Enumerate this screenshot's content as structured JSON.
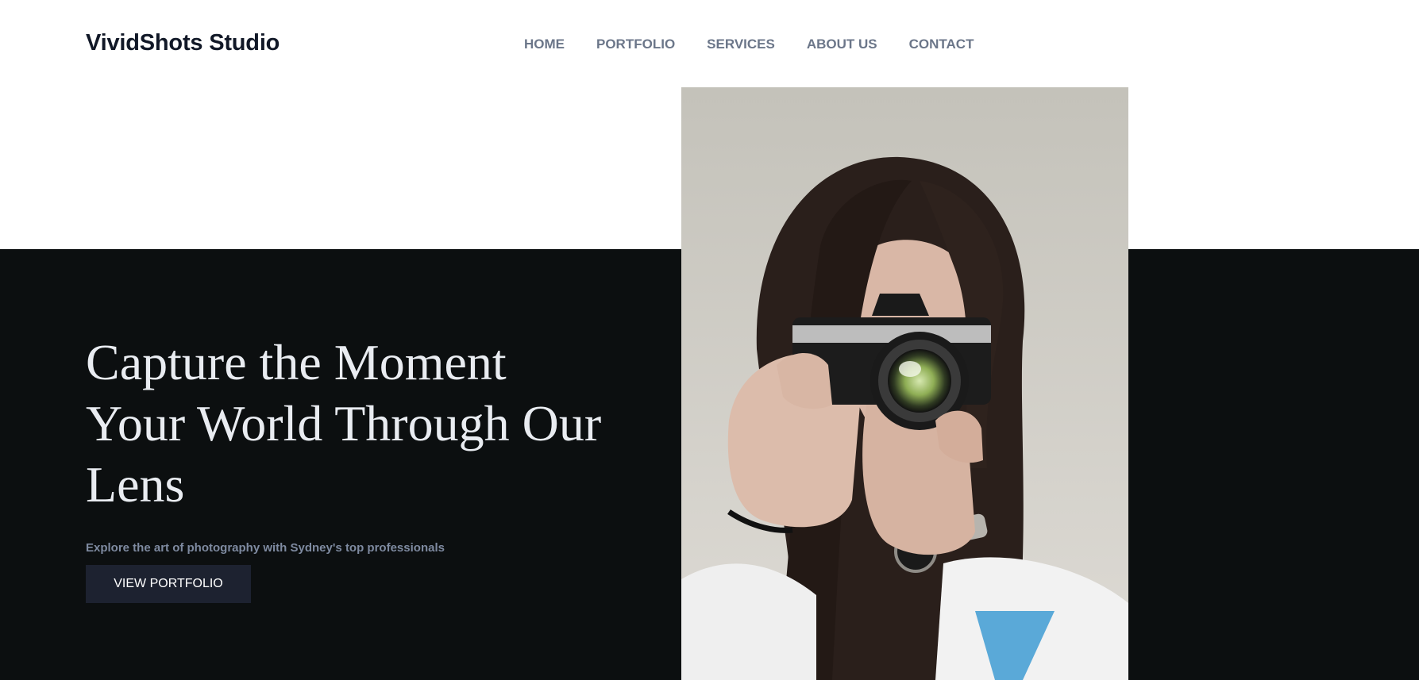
{
  "header": {
    "brand": "VividShots Studio",
    "nav": [
      "HOME",
      "PORTFOLIO",
      "SERVICES",
      "ABOUT US",
      "CONTACT"
    ]
  },
  "hero": {
    "headline_lines": [
      "Capture the Moment",
      "Your World Through Our",
      "Lens"
    ],
    "tagline": "Explore the art of photography with Sydney's top professionals",
    "cta_label": "VIEW PORTFOLIO",
    "image_subject": "woman-with-camera-photo"
  },
  "colors": {
    "hero_background": "#0c0f10",
    "headline_text": "#e9ecf1",
    "nav_text": "#6b7689",
    "button_background": "#1d2230"
  }
}
